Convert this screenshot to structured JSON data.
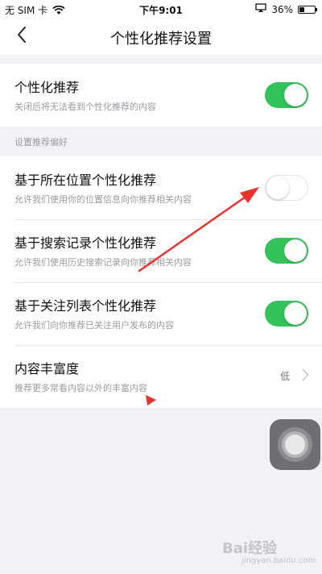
{
  "status_bar": {
    "carrier": "无 SIM 卡",
    "time": "下午9:01",
    "battery": "36%",
    "battery_level": 0.36
  },
  "nav": {
    "title": "个性化推荐设置"
  },
  "personalized": {
    "title": "个性化推荐",
    "subtitle": "关闭后将无法看到个性化推荐的内容",
    "enabled": true
  },
  "section_header": "设置推荐偏好",
  "preferences": [
    {
      "title": "基于所在位置个性化推荐",
      "subtitle": "允许我们使用你的位置信息向你推荐相关内容",
      "enabled": false
    },
    {
      "title": "基于搜索记录个性化推荐",
      "subtitle": "允许我们使用历史搜索记录向你推荐相关内容",
      "enabled": true
    },
    {
      "title": "基于关注列表个性化推荐",
      "subtitle": "允许我们向你推荐已关注用户发布的内容",
      "enabled": true
    }
  ],
  "richness": {
    "title": "内容丰富度",
    "subtitle": "推荐更多常看内容以外的丰富内容",
    "value": "低"
  },
  "watermark": {
    "text": "Bai经验",
    "sub": "jingyan.baidu.com"
  },
  "colors": {
    "toggle_on": "#34c35a",
    "annotation_arrow": "#e8342c"
  }
}
